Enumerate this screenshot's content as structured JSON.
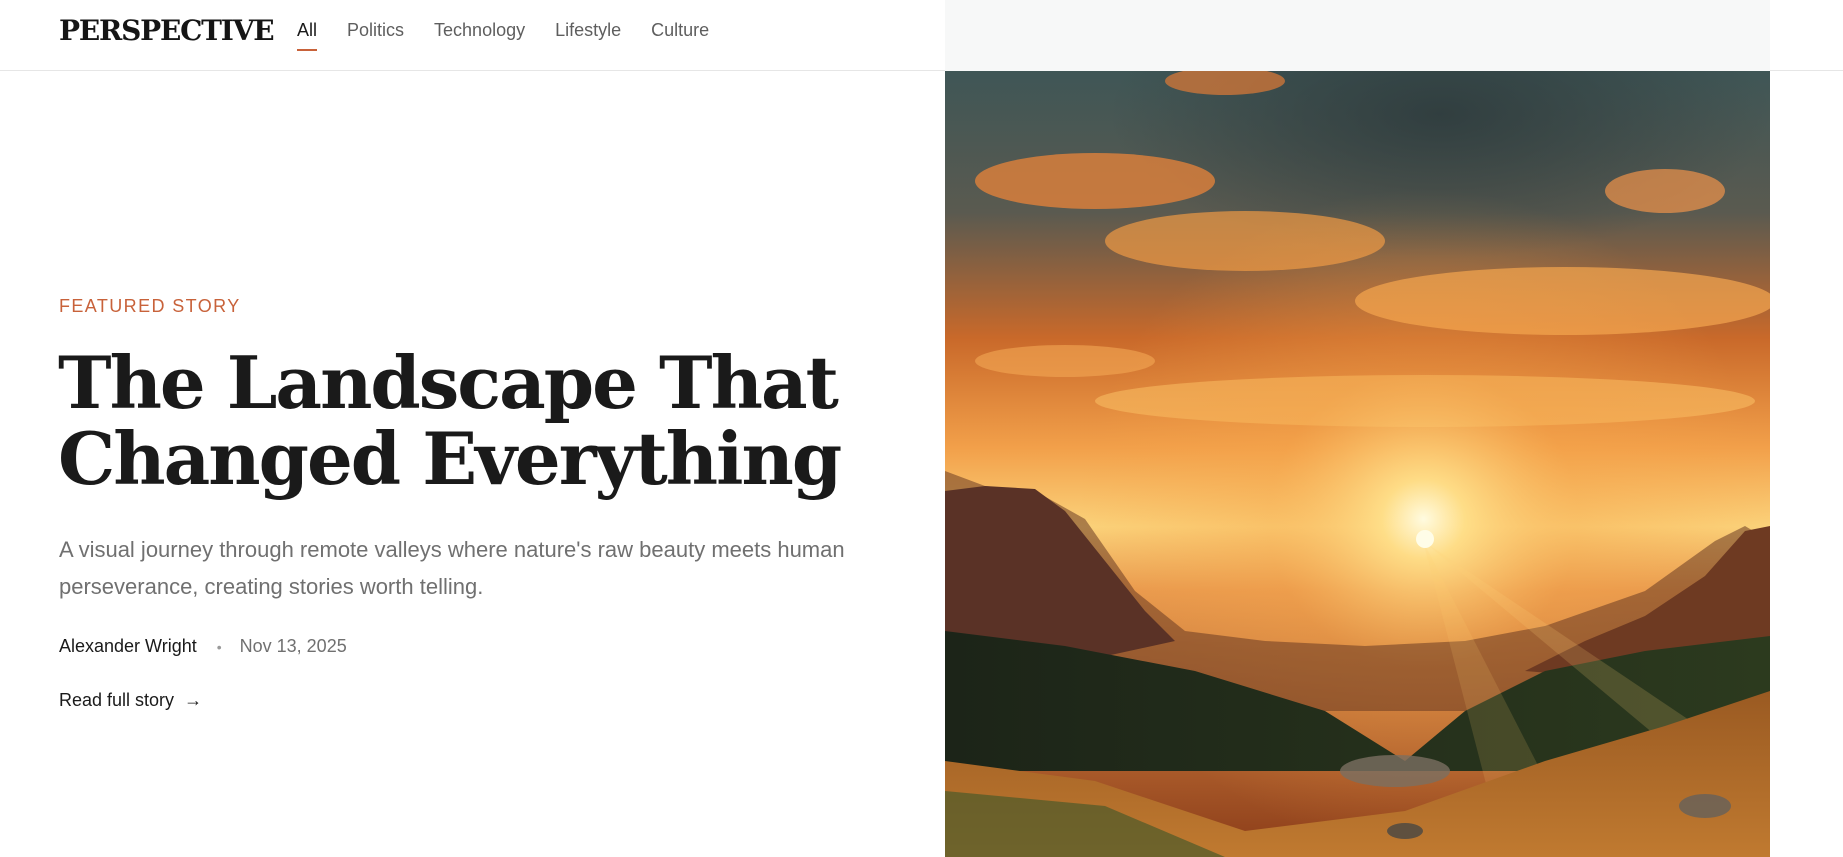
{
  "header": {
    "logo": "PERSPECTIVE",
    "nav": [
      {
        "label": "All",
        "active": true
      },
      {
        "label": "Politics",
        "active": false
      },
      {
        "label": "Technology",
        "active": false
      },
      {
        "label": "Lifestyle",
        "active": false
      },
      {
        "label": "Culture",
        "active": false
      }
    ]
  },
  "article": {
    "kicker": "FEATURED STORY",
    "headline_line1": "The Landscape That",
    "headline_line2": "Changed Everything",
    "dek": "A visual journey through remote valleys where nature's raw beauty meets human perseverance, creating stories worth telling.",
    "author": "Alexander Wright",
    "separator": "•",
    "date": "Nov 13, 2025",
    "read_more": "Read full story",
    "read_more_icon": "arrow-right-icon",
    "read_more_glyph": "→"
  },
  "hero": {
    "subject": "sunset-over-mountain-valley-photo"
  },
  "colors": {
    "accent": "#c8623a",
    "text": "#1a1a1a",
    "muted": "#707070"
  }
}
